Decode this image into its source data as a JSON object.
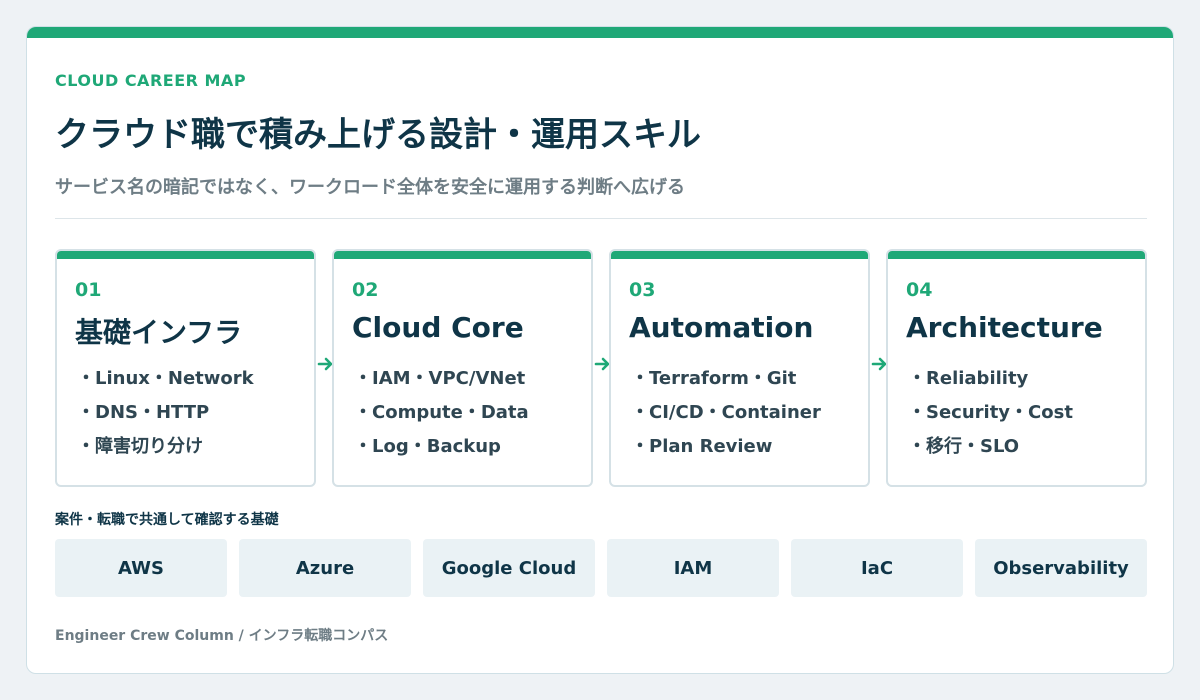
{
  "header": {
    "eyebrow": "CLOUD CAREER MAP",
    "title": "クラウド職で積み上げる設計・運用スキル",
    "subtitle": "サービス名の暗記ではなく、ワークロード全体を安全に運用する判断へ広げる"
  },
  "steps": [
    {
      "number": "01",
      "title": "基礎インフラ",
      "items": [
        "・Linux・Network",
        "・DNS・HTTP",
        "・障害切り分け"
      ]
    },
    {
      "number": "02",
      "title": "Cloud Core",
      "items": [
        "・IAM・VPC/VNet",
        "・Compute・Data",
        "・Log・Backup"
      ]
    },
    {
      "number": "03",
      "title": "Automation",
      "items": [
        "・Terraform・Git",
        "・CI/CD・Container",
        "・Plan Review"
      ]
    },
    {
      "number": "04",
      "title": "Architecture",
      "items": [
        "・Reliability",
        "・Security・Cost",
        "・移行・SLO"
      ]
    }
  ],
  "basis": {
    "label": "案件・転職で共通して確認する基礎",
    "tags": [
      "AWS",
      "Azure",
      "Google Cloud",
      "IAM",
      "IaC",
      "Observability"
    ]
  },
  "footer": "Engineer Crew Column / インフラ転職コンパス",
  "colors": {
    "accent": "#1fa877",
    "heading": "#0f3547",
    "muted": "#6e7d85",
    "tag_bg": "#eaf2f5"
  }
}
